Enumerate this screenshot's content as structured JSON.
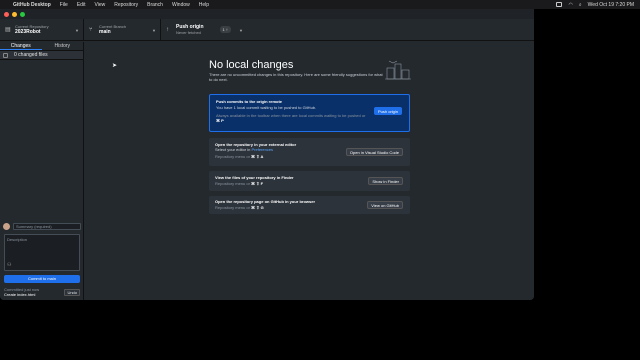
{
  "menubar": {
    "app_name": "GitHub Desktop",
    "items": [
      "File",
      "Edit",
      "View",
      "Repository",
      "Branch",
      "Window",
      "Help"
    ],
    "clock": "Wed Oct 19  7:20 PM"
  },
  "toolbar": {
    "repo_small": "Current Repository",
    "repo_name": "2023Robot",
    "branch_small": "Current Branch",
    "branch_name": "main",
    "push_title": "Push origin",
    "push_sub": "Never fetched",
    "push_badge": "1 ↑"
  },
  "sidebar": {
    "tab_changes": "Changes",
    "tab_history": "History",
    "changed_files": "0 changed files",
    "summary_placeholder": "Summary (required)",
    "description_placeholder": "Description",
    "commit_button": "Commit to main",
    "last_commit_time": "Committed just now",
    "last_commit_title": "Create index.html",
    "undo_label": "Undo"
  },
  "main": {
    "heading": "No local changes",
    "subtext": "There are no uncommitted changes in this repository. Here are some friendly suggestions for what to do next.",
    "push_card": {
      "title": "Push commits to the origin remote",
      "line": "You have 1 local commit waiting to be pushed to GitHub.",
      "hint": "Always available in the toolbar when there are local commits waiting to be pushed or",
      "shortcut": "⌘ P",
      "button": "Push origin"
    },
    "editor_card": {
      "title": "Open the repository in your external editor",
      "line_prefix": "Select your editor in",
      "line_link": "Preferences",
      "hint": "Repository menu or",
      "shortcut": "⌘ ⇧ A",
      "button": "Open in Visual Studio Code"
    },
    "finder_card": {
      "title": "View the files of your repository in Finder",
      "hint": "Repository menu or",
      "shortcut": "⌘ ⇧ F",
      "button": "Show in Finder"
    },
    "github_card": {
      "title": "Open the repository page on GitHub in your browser",
      "hint": "Repository menu or",
      "shortcut": "⌘ ⇧ G",
      "button": "View on GitHub"
    }
  },
  "colors": {
    "accent": "#1f6feb",
    "bg": "#24292e"
  }
}
